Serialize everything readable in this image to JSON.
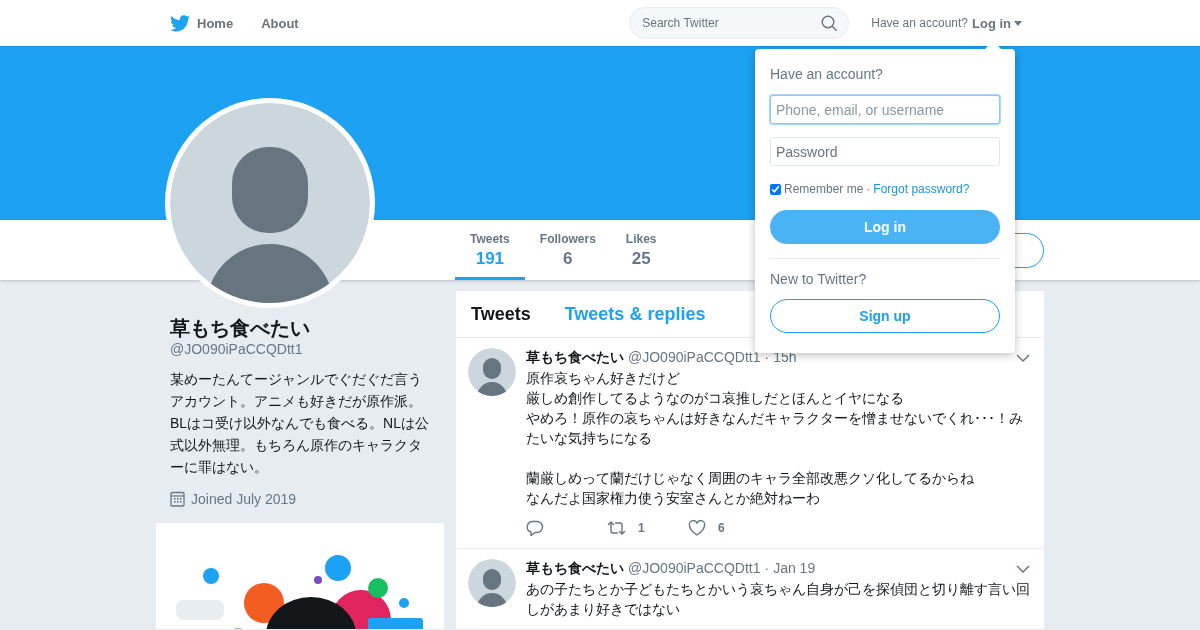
{
  "nav": {
    "items": [
      {
        "label": "Home",
        "kind": "home"
      },
      {
        "label": "About",
        "kind": "plain"
      }
    ],
    "search": {
      "placeholder": "Search Twitter"
    },
    "account_prompt": "Have an account?",
    "login": "Log in"
  },
  "stats": [
    {
      "label": "Tweets",
      "value": "191",
      "selected": true
    },
    {
      "label": "Followers",
      "value": "6",
      "selected": false
    },
    {
      "label": "Likes",
      "value": "25",
      "selected": false
    }
  ],
  "profile": {
    "name": "草もち食べたい",
    "handle": "@JO090iPaCCQDtt1",
    "bio": "某めーたんてージャンルでぐだぐだ言うアカウント。アニメも好きだが原作派。BLはコ受け以外なんでも食べる。NLは公式以外無理。もちろん原作のキャラクターに罪はない。",
    "joined": "Joined July 2019"
  },
  "timeline_tabs": [
    {
      "label": "Tweets",
      "selected": true
    },
    {
      "label": "Tweets & replies",
      "selected": false
    }
  ],
  "tweets": [
    {
      "name": "草もち食べたい",
      "handle": "@JO090iPaCCQDtt1",
      "separator": "·",
      "time": "15h",
      "paragraphs": [
        [
          "原作哀ちゃん好きだけど",
          "厳しめ創作してるようなのがコ哀推しだとほんとイヤになる",
          "やめろ！原作の哀ちゃんは好きなんだキャラクターを憎ませないでくれ･･･！みたいな気持ちになる"
        ],
        [
          "蘭厳しめって蘭だけじゃなく周囲のキャラ全部改悪クソ化してるからね",
          "なんだよ国家権力使う安室さんとか絶対ねーわ"
        ]
      ],
      "retweets": "1",
      "likes": "6"
    },
    {
      "name": "草もち食べたい",
      "handle": "@JO090iPaCCQDtt1",
      "separator": "·",
      "time": "Jan 19",
      "paragraphs": [
        [
          "あの子たちとか子どもたちとかいう哀ちゃん自身が己を探偵団と切り離す言い回しがあまり好きではない"
        ]
      ]
    }
  ],
  "login_dropdown": {
    "heading": "Have an account?",
    "username_placeholder": "Phone, email, or username",
    "password_placeholder": "Password",
    "remember_label": "Remember me",
    "remember_checked": true,
    "separator": "·",
    "forgot": "Forgot password?",
    "submit": "Log in",
    "signup_prompt": "New to Twitter?",
    "signup": "Sign up"
  }
}
